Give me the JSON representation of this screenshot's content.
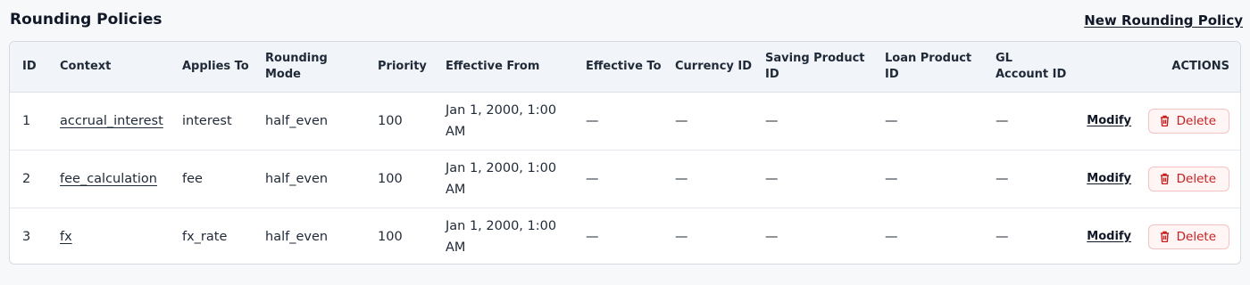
{
  "page": {
    "title": "Rounding Policies",
    "new_link": "New Rounding Policy"
  },
  "table": {
    "headers": {
      "id": "ID",
      "context": "Context",
      "applies_to": "Applies To",
      "rounding_mode": "Rounding Mode",
      "priority": "Priority",
      "effective_from": "Effective From",
      "effective_to": "Effective To",
      "currency_id": "Currency ID",
      "saving_product_id": "Saving Product ID",
      "loan_product_id": "Loan Product ID",
      "gl_account_id": "GL Account ID",
      "actions": "ACTIONS"
    },
    "rows": [
      {
        "id": "1",
        "context": "accrual_interest",
        "applies_to": "interest",
        "rounding_mode": "half_even",
        "priority": "100",
        "effective_from": "Jan 1, 2000, 1:00 AM",
        "effective_to": "—",
        "currency_id": "—",
        "saving_product_id": "—",
        "loan_product_id": "—",
        "gl_account_id": "—",
        "modify": "Modify",
        "delete": "Delete"
      },
      {
        "id": "2",
        "context": "fee_calculation",
        "applies_to": "fee",
        "rounding_mode": "half_even",
        "priority": "100",
        "effective_from": "Jan 1, 2000, 1:00 AM",
        "effective_to": "—",
        "currency_id": "—",
        "saving_product_id": "—",
        "loan_product_id": "—",
        "gl_account_id": "—",
        "modify": "Modify",
        "delete": "Delete"
      },
      {
        "id": "3",
        "context": "fx",
        "applies_to": "fx_rate",
        "rounding_mode": "half_even",
        "priority": "100",
        "effective_from": "Jan 1, 2000, 1:00 AM",
        "effective_to": "—",
        "currency_id": "—",
        "saving_product_id": "—",
        "loan_product_id": "—",
        "gl_account_id": "—",
        "modify": "Modify",
        "delete": "Delete"
      }
    ]
  },
  "icons": {
    "delete": "trash-icon"
  },
  "colors": {
    "danger": "#c81e1e",
    "danger_bg": "#fff5f5"
  }
}
